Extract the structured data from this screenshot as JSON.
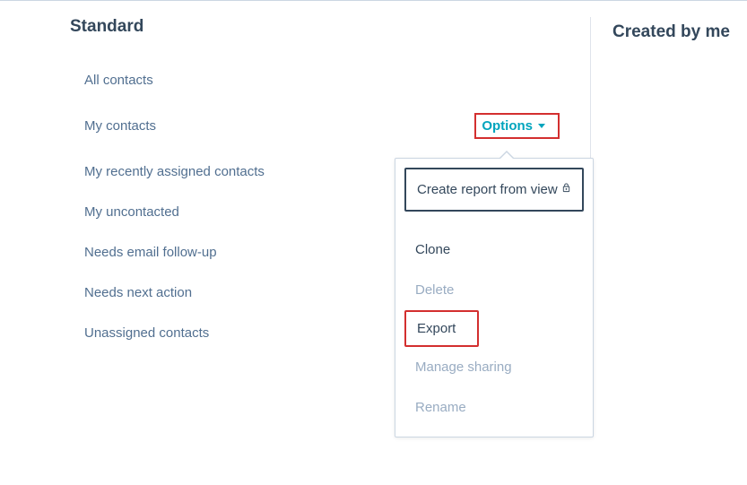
{
  "standard": {
    "title": "Standard",
    "items": [
      "All contacts",
      "My contacts",
      "My recently assigned contacts",
      "My uncontacted",
      "Needs email follow-up",
      "Needs next action",
      "Unassigned contacts"
    ],
    "options_label": "Options"
  },
  "created_by_me": {
    "title": "Created by me"
  },
  "dropdown": {
    "create_report": "Create report from view",
    "clone": "Clone",
    "delete": "Delete",
    "export": "Export",
    "manage_sharing": "Manage sharing",
    "rename": "Rename"
  }
}
